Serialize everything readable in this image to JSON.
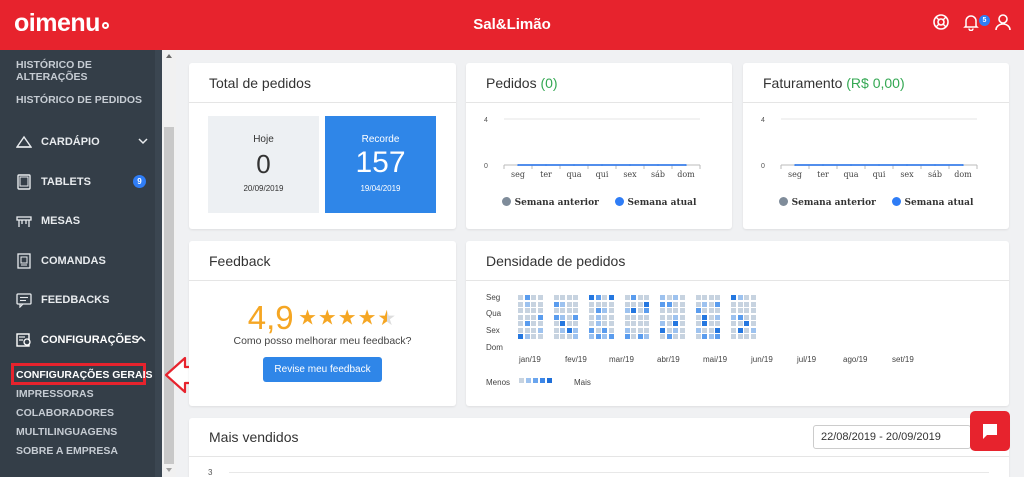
{
  "header": {
    "logo": "oimenu",
    "store_name": "Sal&Limão",
    "notification_count": "5",
    "icons": [
      "help-icon",
      "notification-bell-icon",
      "user-icon"
    ],
    "brand_color": "#e7232d"
  },
  "sidebar": {
    "top_links": [
      "HISTÓRICO DE",
      "ALTERAÇÕES",
      "HISTÓRICO DE PEDIDOS"
    ],
    "items": [
      {
        "label": "CARDÁPIO",
        "icon": "menu-book-icon",
        "chevron": "down"
      },
      {
        "label": "TABLETS",
        "icon": "tablet-icon",
        "badge": "9"
      },
      {
        "label": "MESAS",
        "icon": "table-icon"
      },
      {
        "label": "COMANDAS",
        "icon": "order-ticket-icon"
      },
      {
        "label": "FEEDBACKS",
        "icon": "feedback-icon"
      },
      {
        "label": "CONFIGURAÇÕES",
        "icon": "settings-icon",
        "chevron": "up"
      }
    ],
    "sub_items": [
      "CONFIGURAÇÕES GERAIS",
      "IMPRESSORAS",
      "COLABORADORES",
      "MULTILINGUAGENS",
      "SOBRE A EMPRESA"
    ],
    "active_sub_item": "CONFIGURAÇÕES GERAIS"
  },
  "total_pedidos": {
    "title": "Total de pedidos",
    "today": {
      "label": "Hoje",
      "value": "0",
      "date": "20/09/2019"
    },
    "record": {
      "label": "Recorde",
      "value": "157",
      "date": "19/04/2019"
    }
  },
  "pedidos": {
    "title": "Pedidos",
    "count": "(0)"
  },
  "faturamento": {
    "title": "Faturamento",
    "amount": "(R$ 0,00)"
  },
  "week_legend": {
    "previous": "Semana anterior",
    "current": "Semana atual"
  },
  "feedback": {
    "title": "Feedback",
    "score": "4,9",
    "stars": 4.5,
    "question": "Como posso melhorar meu feedback?",
    "button": "Revise meu feedback"
  },
  "densidade": {
    "title": "Densidade de pedidos",
    "day_labels": [
      "Seg",
      "Qua",
      "Sex",
      "Dom"
    ],
    "month_labels": [
      "jan/19",
      "fev/19",
      "mar/19",
      "abr/19",
      "mai/19",
      "jun/19",
      "jul/19",
      "ago/19",
      "set/19"
    ],
    "legend_less": "Menos",
    "legend_more": "Mais"
  },
  "mais_vendidos": {
    "title": "Mais vendidos",
    "date_range": "22/08/2019 - 20/09/2019",
    "y_tick": "3"
  },
  "chart_data": [
    {
      "type": "line",
      "title": "Pedidos (0)",
      "categories": [
        "seg",
        "ter",
        "qua",
        "qui",
        "sex",
        "sáb",
        "dom"
      ],
      "yticks": [
        "4",
        "0"
      ],
      "ylim": [
        0,
        4
      ],
      "series": [
        {
          "name": "Semana anterior",
          "color": "#7f8c9a",
          "values": [
            0,
            0,
            0,
            0,
            0,
            0,
            0
          ]
        },
        {
          "name": "Semana atual",
          "color": "#2f7df6",
          "values": [
            0,
            0,
            0,
            0,
            0,
            0,
            0
          ]
        }
      ],
      "legend": "bottom"
    },
    {
      "type": "line",
      "title": "Faturamento (R$ 0,00)",
      "categories": [
        "seg",
        "ter",
        "qua",
        "qui",
        "sex",
        "sáb",
        "dom"
      ],
      "yticks": [
        "4",
        "0"
      ],
      "ylim": [
        0,
        4
      ],
      "series": [
        {
          "name": "Semana anterior",
          "color": "#7f8c9a",
          "values": [
            0,
            0,
            0,
            0,
            0,
            0,
            0
          ]
        },
        {
          "name": "Semana atual",
          "color": "#2f7df6",
          "values": [
            0,
            0,
            0,
            0,
            0,
            0,
            0
          ]
        }
      ],
      "legend": "bottom"
    }
  ]
}
